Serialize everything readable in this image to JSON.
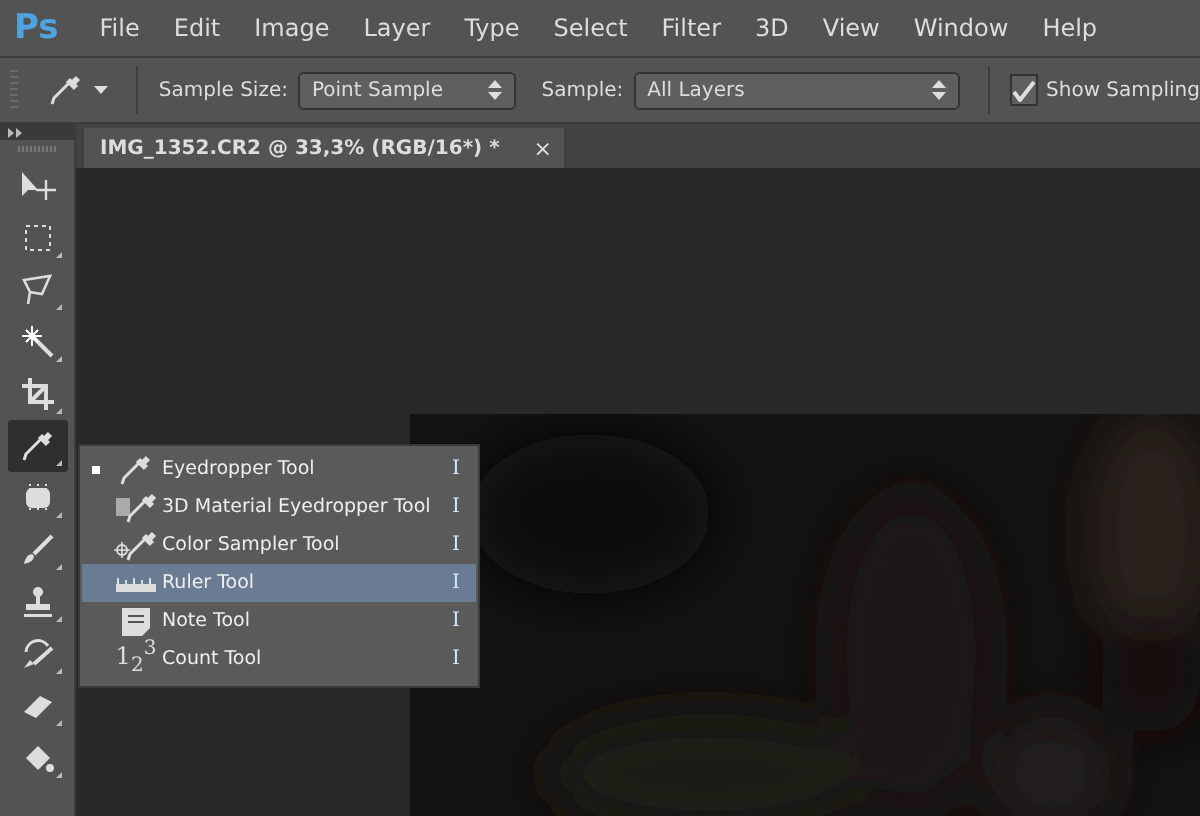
{
  "app_logo": "Ps",
  "menu": [
    "File",
    "Edit",
    "Image",
    "Layer",
    "Type",
    "Select",
    "Filter",
    "3D",
    "View",
    "Window",
    "Help"
  ],
  "options_bar": {
    "sample_size_label": "Sample Size:",
    "sample_size": "Point Sample",
    "sample_label": "Sample:",
    "sample": "All Layers",
    "show_sampling_ring": {
      "label": "Show Sampling",
      "checked": true
    }
  },
  "document_tab": {
    "title": "IMG_1352.CR2 @ 33,3% (RGB/16*) *",
    "close": "×"
  },
  "toolbar": [
    {
      "kind": "move",
      "selected": false
    },
    {
      "kind": "marquee",
      "selected": false
    },
    {
      "kind": "lasso",
      "selected": false
    },
    {
      "kind": "wand",
      "selected": false
    },
    {
      "kind": "crop",
      "selected": false
    },
    {
      "kind": "eyedropper",
      "selected": true
    },
    {
      "kind": "healing",
      "selected": false
    },
    {
      "kind": "brush",
      "selected": false
    },
    {
      "kind": "stamp",
      "selected": false
    },
    {
      "kind": "history",
      "selected": false
    },
    {
      "kind": "eraser",
      "selected": false
    },
    {
      "kind": "bucket",
      "selected": false
    }
  ],
  "flyout": [
    {
      "kind": "eyedropper",
      "label": "Eyedropper Tool",
      "shortcut": "I",
      "current": true,
      "selected": false
    },
    {
      "kind": "material",
      "label": "3D Material Eyedropper Tool",
      "shortcut": "I",
      "current": false,
      "selected": false
    },
    {
      "kind": "sampler",
      "label": "Color Sampler Tool",
      "shortcut": "I",
      "current": false,
      "selected": false
    },
    {
      "kind": "ruler",
      "label": "Ruler Tool",
      "shortcut": "I",
      "current": false,
      "selected": true
    },
    {
      "kind": "note",
      "label": "Note Tool",
      "shortcut": "I",
      "current": false,
      "selected": false
    },
    {
      "kind": "count",
      "label": "Count Tool",
      "shortcut": "I",
      "current": false,
      "selected": false,
      "icon_text": "1$_{2}$$^{3}$"
    }
  ],
  "canvas": {
    "kind": "picture"
  }
}
